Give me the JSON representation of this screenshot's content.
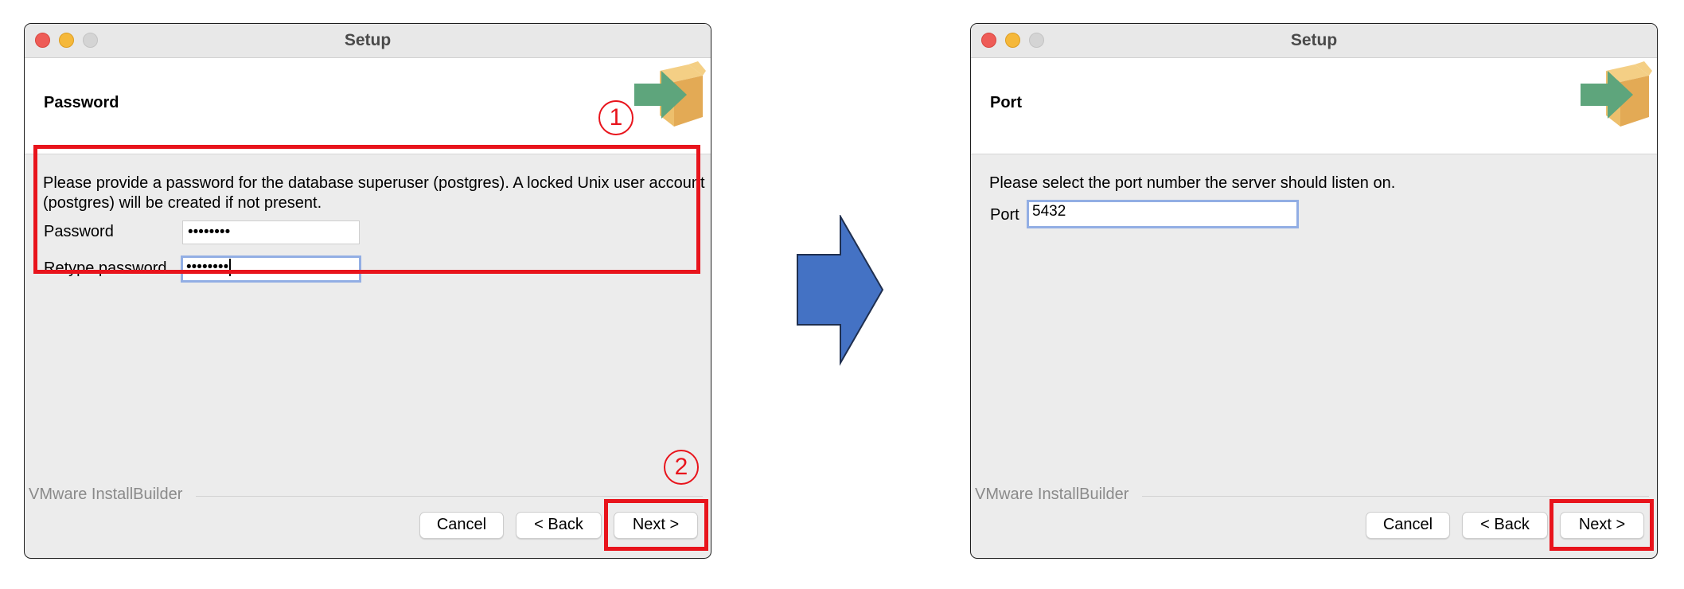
{
  "window_left": {
    "title": "Setup",
    "header_title": "Password",
    "description": "Please provide a password for the database superuser (postgres). A locked Unix user account (postgres) will be created if not present.",
    "password_label": "Password",
    "password_value": "••••••••",
    "retype_label": "Retype password",
    "retype_value": "••••••••",
    "brand": "VMware InstallBuilder",
    "cancel_label": "Cancel",
    "back_label": "< Back",
    "next_label": "Next >"
  },
  "window_right": {
    "title": "Setup",
    "header_title": "Port",
    "description": "Please select the port number the server should listen on.",
    "port_label": "Port",
    "port_value": "5432",
    "brand": "VMware InstallBuilder",
    "cancel_label": "Cancel",
    "back_label": "< Back",
    "next_label": "Next >"
  },
  "annotations": {
    "step1": "1",
    "step2": "2",
    "highlight_color": "#e8141c",
    "arrow_color": "#4472c4"
  },
  "icons": {
    "installer_icon": "installer-box-arrow-icon",
    "flow_arrow": "right-arrow-icon"
  }
}
